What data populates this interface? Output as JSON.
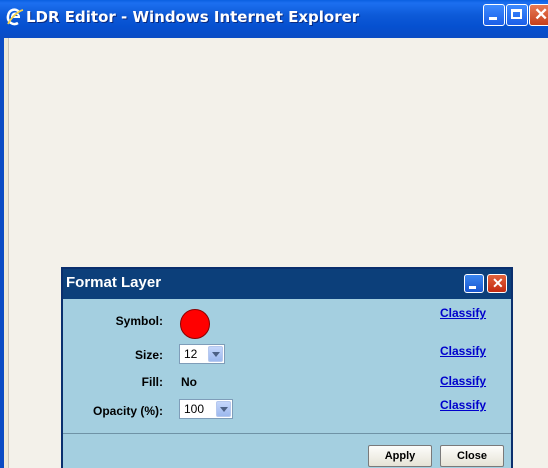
{
  "window": {
    "title": "LDR Editor - Windows Internet Explorer",
    "icon": "ie-e-logo-icon"
  },
  "dialog": {
    "title": "Format Layer",
    "rows": [
      {
        "label": "Symbol:",
        "link": "Classify"
      },
      {
        "label": "Size:",
        "value": "12",
        "link": "Classify"
      },
      {
        "label": "Fill:",
        "value": "No",
        "link": "Classify"
      },
      {
        "label": "Opacity (%):",
        "value": "100",
        "link": "Classify"
      }
    ],
    "symbol_color": "#ff0000",
    "apply_label": "Apply",
    "close_label": "Close"
  }
}
